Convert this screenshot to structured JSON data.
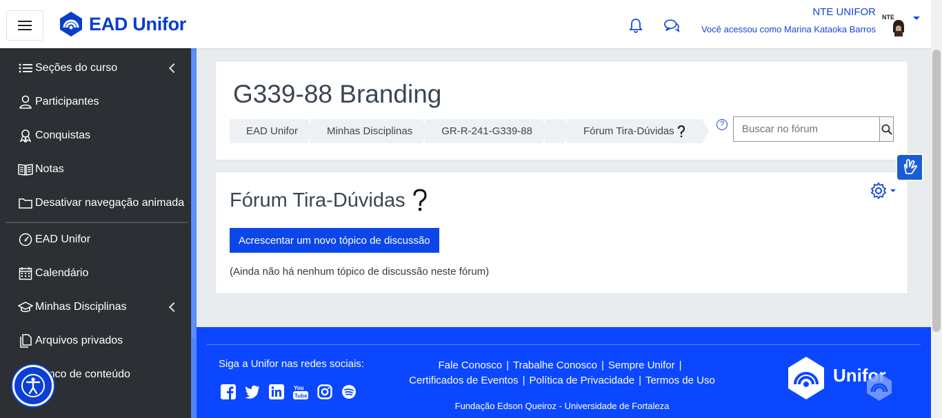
{
  "header": {
    "brand": "EAD Unifor",
    "org_name": "NTE UNIFOR",
    "logged_in_as": "Você acessou como Marina Kataoka Barros",
    "avatar_label": "NTE"
  },
  "sidebar": {
    "items": [
      {
        "label": "Seções do curso"
      },
      {
        "label": "Participantes"
      },
      {
        "label": "Conquistas"
      },
      {
        "label": "Notas"
      },
      {
        "label": "Desativar navegação animada"
      },
      {
        "label": "EAD Unifor"
      },
      {
        "label": "Calendário"
      },
      {
        "label": "Minhas Disciplinas"
      },
      {
        "label": "Arquivos privados"
      },
      {
        "label": "Banco de conteúdo"
      }
    ]
  },
  "course": {
    "title": "G339-88 Branding",
    "breadcrumb": [
      "EAD Unifor",
      "Minhas Disciplinas",
      "GR-R-241-G339-88",
      "Fórum Tira-Dúvidas"
    ],
    "search_placeholder": "Buscar no fórum"
  },
  "forum": {
    "title": "Fórum Tira-Dúvidas",
    "add_button": "Acrescentar um novo tópico de discussão",
    "empty_message": "(Ainda não há nenhum tópico de discussão neste fórum)"
  },
  "footer": {
    "social_label": "Siga a Unifor nas redes sociais:",
    "links_row1": [
      "Fale Conosco",
      "Trabalhe Conosco",
      "Sempre Unifor"
    ],
    "links_row2": [
      "Certificados de Eventos",
      "Política de Privacidade",
      "Termos de Uso"
    ],
    "foundation": "Fundação Edson Queiroz - Universidade de Fortaleza",
    "logo_text": "Unifor"
  },
  "colors": {
    "brand_blue": "#0b47ff",
    "sidebar_bg": "#2c3034",
    "primary_button": "#0b47e8"
  }
}
